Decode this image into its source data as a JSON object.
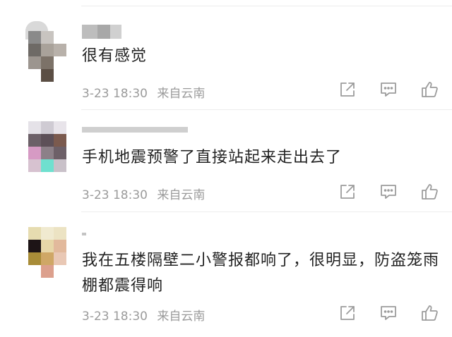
{
  "comments": [
    {
      "username": "",
      "text": "很有感觉",
      "date": "3-23 18:30",
      "location": "来自云南"
    },
    {
      "username": "",
      "text": "手机地震预警了直接站起来走出去了",
      "date": "3-23 18:30",
      "location": "来自云南"
    },
    {
      "username": "",
      "text": "我在五楼隔壁二小警报都响了，很明显，防盗笼雨棚都震得响",
      "date": "3-23 18:30",
      "location": "来自云南"
    }
  ],
  "icons": {
    "share": "share-icon",
    "comment": "comment-icon",
    "like": "thumbs-up-icon"
  },
  "colors": {
    "text": "#222222",
    "meta": "#9b9b9b",
    "icon": "#9c9c9c",
    "divider": "#ececec"
  }
}
